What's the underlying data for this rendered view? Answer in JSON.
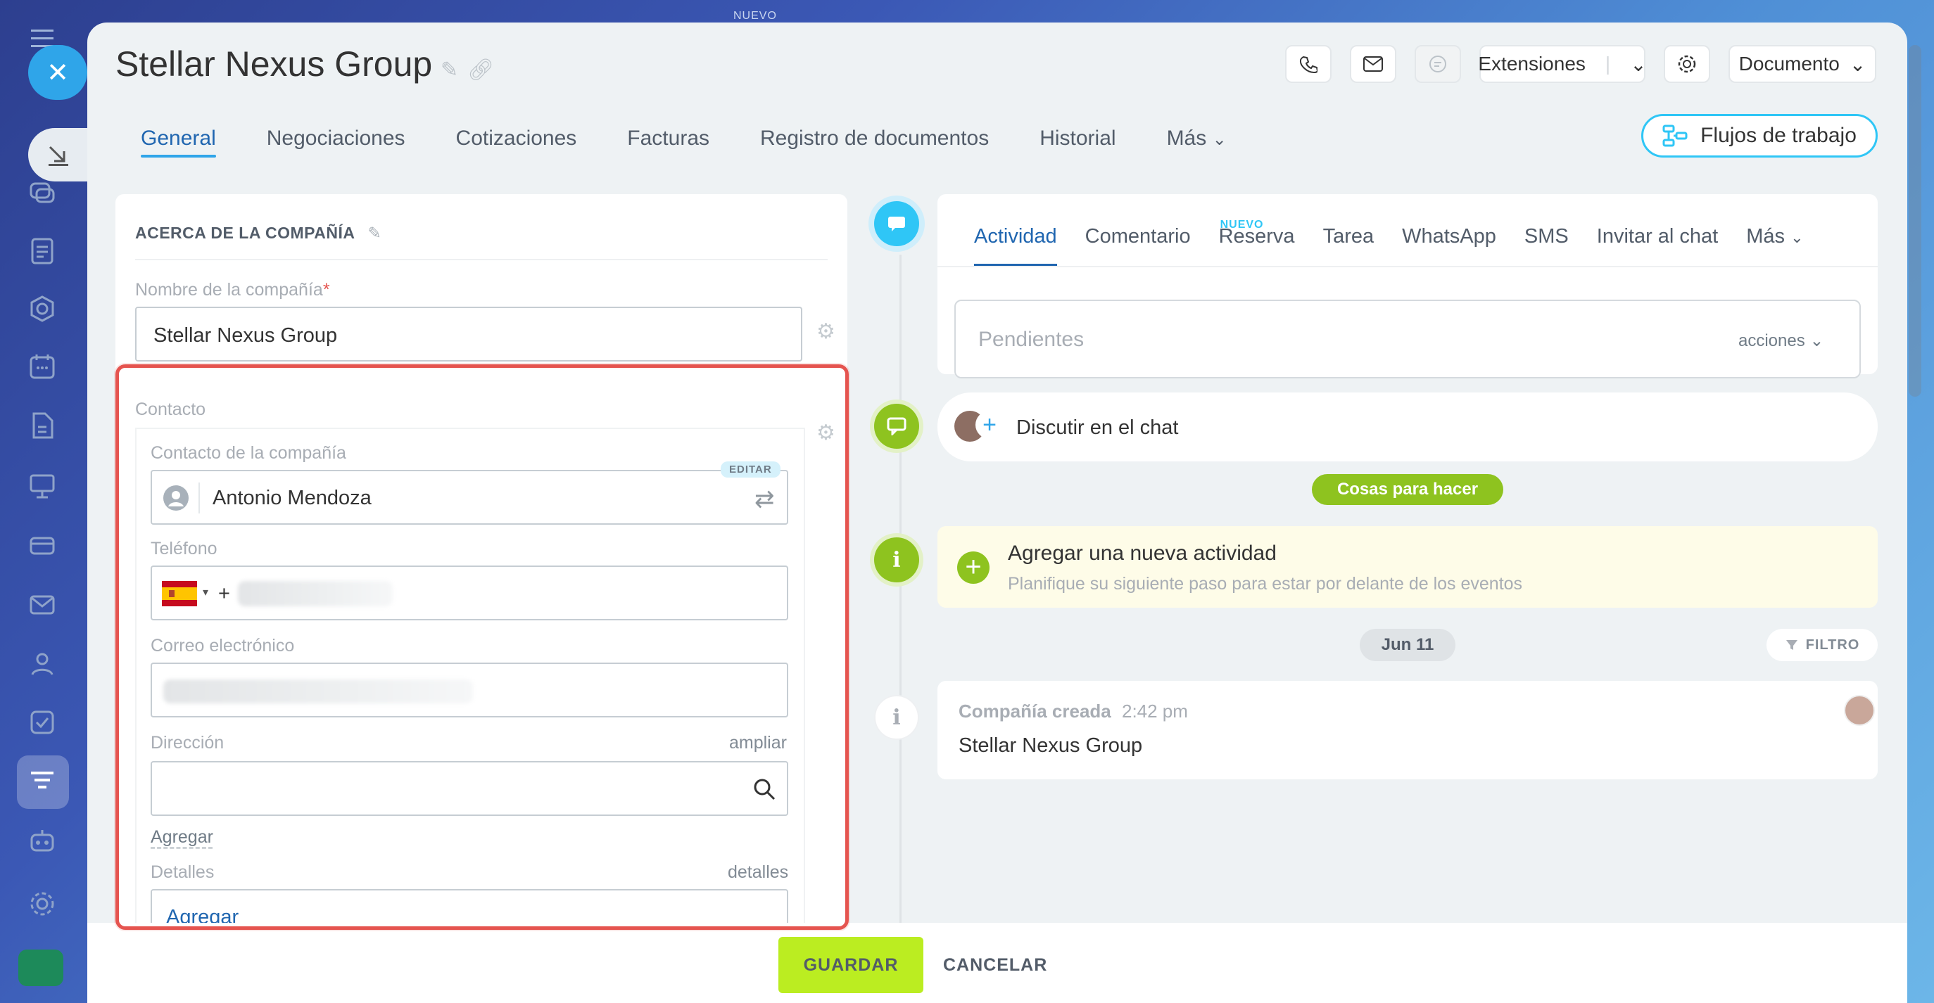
{
  "rail": {
    "new_badge": "NUEVO"
  },
  "header": {
    "title": "Stellar Nexus Group",
    "extensions_label": "Extensiones",
    "document_label": "Documento"
  },
  "tabs": [
    "General",
    "Negociaciones",
    "Cotizaciones",
    "Facturas",
    "Registro de documentos",
    "Historial",
    "Más"
  ],
  "workflows_label": "Flujos de trabajo",
  "company": {
    "section_title": "ACERCA DE LA COMPAÑÍA",
    "name_label": "Nombre de la compañía",
    "name_value": "Stellar Nexus Group",
    "contact_section": "Contacto",
    "contact_label": "Contacto de la compañía",
    "edit_badge": "EDITAR",
    "contact_value": "Antonio Mendoza",
    "phone_label": "Teléfono",
    "phone_prefix": "+",
    "email_label": "Correo electrónico",
    "address_label": "Dirección",
    "address_expand": "ampliar",
    "add_label": "Agregar",
    "details_label": "Detalles",
    "details_link": "detalles",
    "details_add": "Agregar"
  },
  "activity": {
    "tabs": [
      "Actividad",
      "Comentario",
      "Reserva",
      "Tarea",
      "WhatsApp",
      "SMS",
      "Invitar al chat",
      "Más"
    ],
    "new_badge": "NUEVO",
    "pending_placeholder": "Pendientes",
    "actions_label": "acciones",
    "chat_label": "Discutir en el chat",
    "todo_badge": "Cosas para hacer",
    "new_activity_title": "Agregar una nueva actividad",
    "new_activity_sub": "Planifique su siguiente paso para estar por delante de los eventos",
    "date_badge": "Jun 11",
    "filter_label": "FILTRO",
    "created_title": "Compañía creada",
    "created_time": "2:42 pm",
    "created_value": "Stellar Nexus Group"
  },
  "footer": {
    "save": "GUARDAR",
    "cancel": "CANCELAR"
  },
  "colors": {
    "accent": "#2fa5e9",
    "save": "#bbed21",
    "highlight": "#e5544f",
    "timeline_green": "#8ec31f"
  }
}
